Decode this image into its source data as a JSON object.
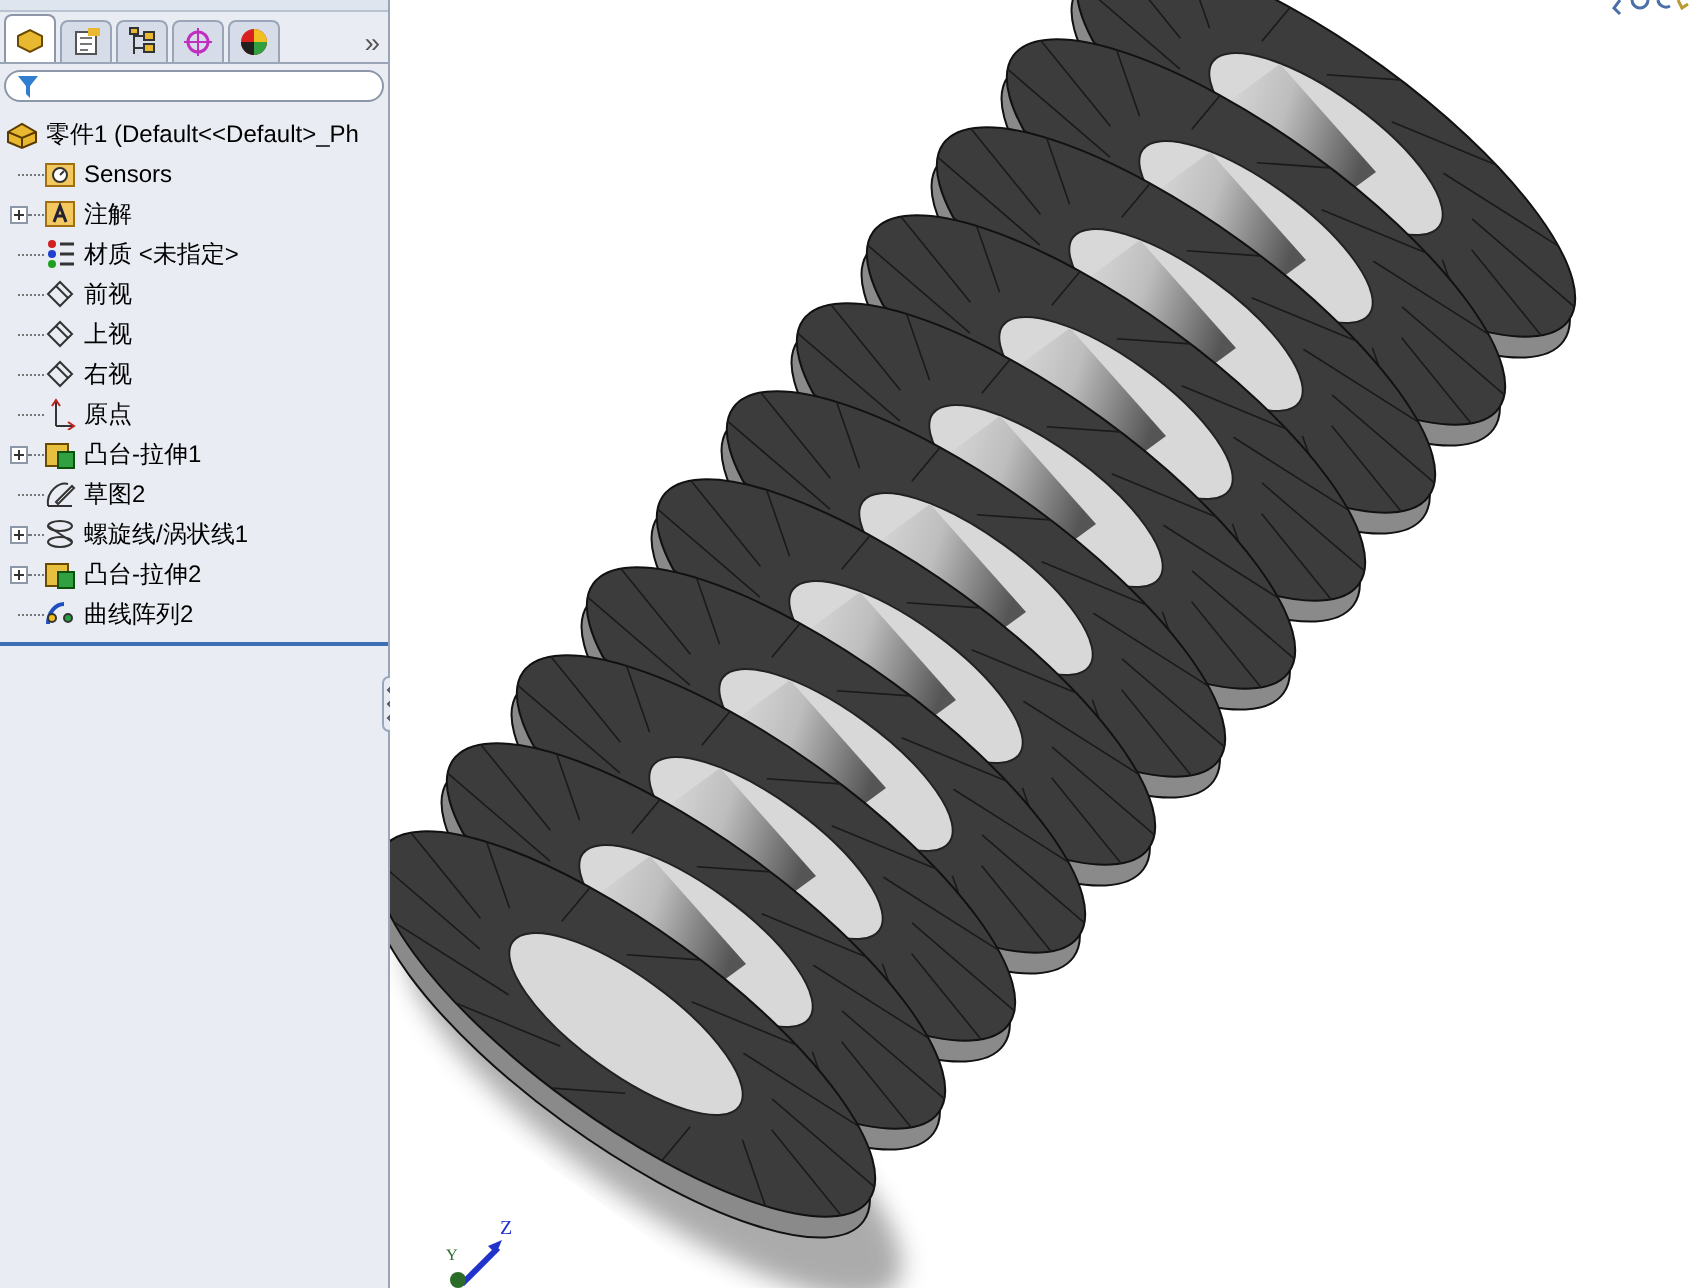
{
  "tabs": [
    {
      "kind": "feature-manager",
      "selected": true
    },
    {
      "kind": "property-manager",
      "selected": false
    },
    {
      "kind": "configuration-manager",
      "selected": false
    },
    {
      "kind": "dimxpert",
      "selected": false
    },
    {
      "kind": "display-manager",
      "selected": false
    }
  ],
  "tabs_overflow": "»",
  "tree": {
    "label": "零件1  (Default<<Default>_Ph",
    "kind": "part",
    "children": [
      {
        "label": "Sensors",
        "kind": "sensors",
        "collapsed": false
      },
      {
        "label": "注解",
        "kind": "annotations",
        "collapsed": true
      },
      {
        "label": "材质 <未指定>",
        "kind": "material",
        "collapsed": false
      },
      {
        "label": "前视",
        "kind": "plane",
        "collapsed": false
      },
      {
        "label": "上视",
        "kind": "plane",
        "collapsed": false
      },
      {
        "label": "右视",
        "kind": "plane",
        "collapsed": false
      },
      {
        "label": "原点",
        "kind": "origin",
        "collapsed": false
      },
      {
        "label": "凸台-拉伸1",
        "kind": "extrude",
        "collapsed": true
      },
      {
        "label": "草图2",
        "kind": "sketch",
        "collapsed": false
      },
      {
        "label": "螺旋线/涡状线1",
        "kind": "helix",
        "collapsed": true
      },
      {
        "label": "凸台-拉伸2",
        "kind": "extrude",
        "collapsed": true
      },
      {
        "label": "曲线阵列2",
        "kind": "pattern",
        "collapsed": false
      }
    ]
  },
  "triad": {
    "z": "Z",
    "y": "Y"
  }
}
